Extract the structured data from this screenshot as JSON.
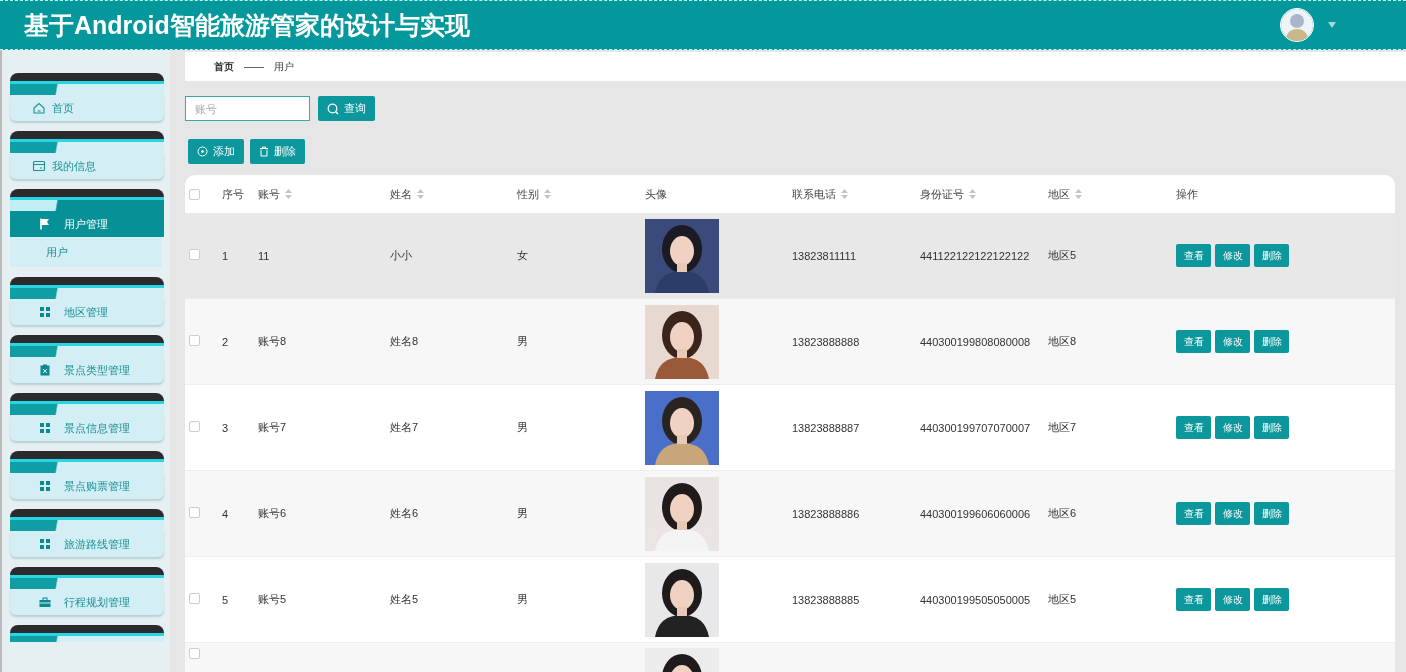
{
  "header": {
    "title": "基于Android智能旅游管家的设计与实现"
  },
  "sidebar": {
    "items": [
      {
        "label": "首页",
        "selected": false,
        "expanded": false
      },
      {
        "label": "我的信息",
        "selected": false,
        "expanded": false
      },
      {
        "label": "用户管理",
        "selected": true,
        "expanded": true,
        "children": [
          {
            "label": "用户",
            "selected": false
          }
        ]
      },
      {
        "label": "地区管理",
        "selected": false,
        "expanded": false
      },
      {
        "label": "景点类型管理",
        "selected": false,
        "expanded": false
      },
      {
        "label": "景点信息管理",
        "selected": false,
        "expanded": false
      },
      {
        "label": "景点购票管理",
        "selected": false,
        "expanded": false
      },
      {
        "label": "旅游路线管理",
        "selected": false,
        "expanded": false
      },
      {
        "label": "行程规划管理",
        "selected": false,
        "expanded": false
      },
      {
        "kind": "partial",
        "selected": false,
        "expanded": false
      }
    ]
  },
  "breadcrumb": {
    "items": [
      "首页",
      "用户"
    ],
    "separator": "——"
  },
  "search": {
    "placeholder": "账号",
    "button": "查询"
  },
  "actions": [
    "添加",
    "删除"
  ],
  "table": {
    "header_checkbox": {
      "checked": false
    },
    "columns": [
      {
        "label": "序号",
        "sortable": false
      },
      {
        "label": "账号",
        "sortable": true
      },
      {
        "label": "姓名",
        "sortable": true
      },
      {
        "label": "性别",
        "sortable": true
      },
      {
        "label": "头像",
        "sortable": false
      },
      {
        "label": "联系电话",
        "sortable": true
      },
      {
        "label": "身份证号",
        "sortable": true
      },
      {
        "label": "地区",
        "sortable": true
      },
      {
        "label": "操作",
        "sortable": false
      }
    ],
    "rows": [
      {
        "checked": false,
        "hovered": true,
        "index": "1",
        "account": "11",
        "name": "小小",
        "gender": "女",
        "phone": "13823811111",
        "id_number": "441122122122122122",
        "region": "地区5",
        "actions": [
          "查看",
          "修改",
          "删除"
        ]
      },
      {
        "checked": false,
        "hovered": false,
        "index": "2",
        "account": "账号8",
        "name": "姓名8",
        "gender": "男",
        "phone": "13823888888",
        "id_number": "440300199808080008",
        "region": "地区8",
        "actions": [
          "查看",
          "修改",
          "删除"
        ]
      },
      {
        "checked": false,
        "hovered": false,
        "index": "3",
        "account": "账号7",
        "name": "姓名7",
        "gender": "男",
        "phone": "13823888887",
        "id_number": "440300199707070007",
        "region": "地区7",
        "actions": [
          "查看",
          "修改",
          "删除"
        ]
      },
      {
        "checked": false,
        "hovered": false,
        "index": "4",
        "account": "账号6",
        "name": "姓名6",
        "gender": "男",
        "phone": "13823888886",
        "id_number": "440300199606060006",
        "region": "地区6",
        "actions": [
          "查看",
          "修改",
          "删除"
        ]
      },
      {
        "checked": false,
        "hovered": false,
        "index": "5",
        "account": "账号5",
        "name": "姓名5",
        "gender": "男",
        "phone": "13823888885",
        "id_number": "440300199505050005",
        "region": "地区5",
        "actions": [
          "查看",
          "修改",
          "删除"
        ]
      },
      {
        "kind": "partial",
        "checked": false,
        "hovered": false
      }
    ]
  }
}
